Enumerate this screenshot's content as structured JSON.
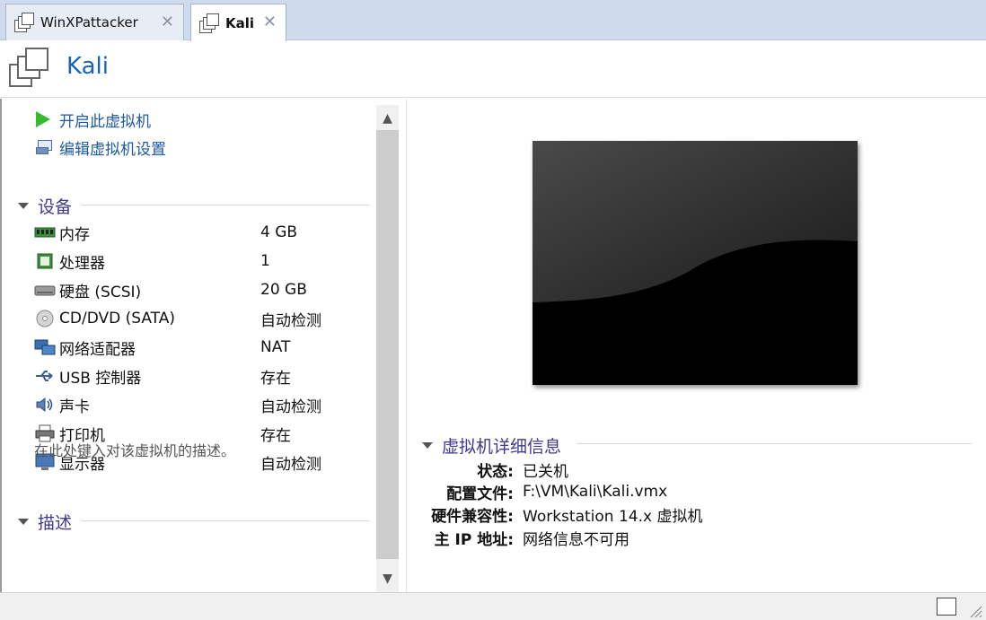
{
  "tabs": [
    {
      "label": "WinXPattacker",
      "active": false
    },
    {
      "label": "Kali",
      "active": true
    }
  ],
  "vm_title": "Kali",
  "actions": {
    "power_on": "开启此虚拟机",
    "edit_settings": "编辑虚拟机设置"
  },
  "devices": {
    "heading": "设备",
    "items": [
      {
        "label": "内存",
        "value": "4 GB",
        "icon": "memory-icon"
      },
      {
        "label": "处理器",
        "value": "1",
        "icon": "cpu-icon"
      },
      {
        "label": "硬盘 (SCSI)",
        "value": "20 GB",
        "icon": "harddisk-icon"
      },
      {
        "label": "CD/DVD (SATA)",
        "value": "自动检测",
        "icon": "cd-icon"
      },
      {
        "label": "网络适配器",
        "value": "NAT",
        "icon": "network-icon"
      },
      {
        "label": "USB 控制器",
        "value": "存在",
        "icon": "usb-icon"
      },
      {
        "label": "声卡",
        "value": "自动检测",
        "icon": "sound-icon"
      },
      {
        "label": "打印机",
        "value": "存在",
        "icon": "printer-icon"
      },
      {
        "label": "显示器",
        "value": "自动检测",
        "icon": "display-icon"
      }
    ]
  },
  "description": {
    "heading": "描述",
    "placeholder": "在此处键入对该虚拟机的描述。"
  },
  "details": {
    "heading": "虚拟机详细信息",
    "rows": [
      {
        "key": "状态:",
        "value": "已关机"
      },
      {
        "key": "配置文件:",
        "value": "F:\\VM\\Kali\\Kali.vmx"
      },
      {
        "key": "硬件兼容性:",
        "value": "Workstation 14.x 虚拟机"
      },
      {
        "key": "主 IP 地址:",
        "value": "网络信息不可用"
      }
    ]
  },
  "colors": {
    "accent": "#1a63b8",
    "section": "#3d3b8e",
    "play": "#36b82f"
  }
}
